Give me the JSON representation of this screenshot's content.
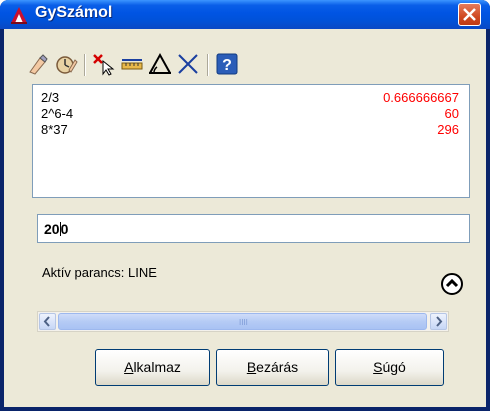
{
  "window": {
    "title": "GySzámol"
  },
  "toolbar": {
    "icons": [
      "eraser-icon",
      "clear-history-icon",
      "get-value-icon",
      "measure-distance-icon",
      "measure-angle-icon",
      "intersection-icon",
      "help-icon"
    ]
  },
  "history": [
    {
      "expr": "2/3",
      "value": "0.666666667"
    },
    {
      "expr": "2^6-4",
      "value": "60"
    },
    {
      "expr": "8*37",
      "value": "296"
    }
  ],
  "input": {
    "before_caret": "20",
    "after_caret": "0"
  },
  "status": {
    "text": "Aktív parancs: LINE"
  },
  "scrollbar": {
    "grip": "IIII"
  },
  "buttons": {
    "apply": {
      "first": "A",
      "rest": "lkalmaz"
    },
    "close": {
      "first": "B",
      "rest": "ezárás"
    },
    "help": {
      "first": "S",
      "rest": "úgó"
    }
  },
  "colors": {
    "result": "#ff0000",
    "title_bar": "#0054e3",
    "client_bg": "#ece9d8"
  }
}
